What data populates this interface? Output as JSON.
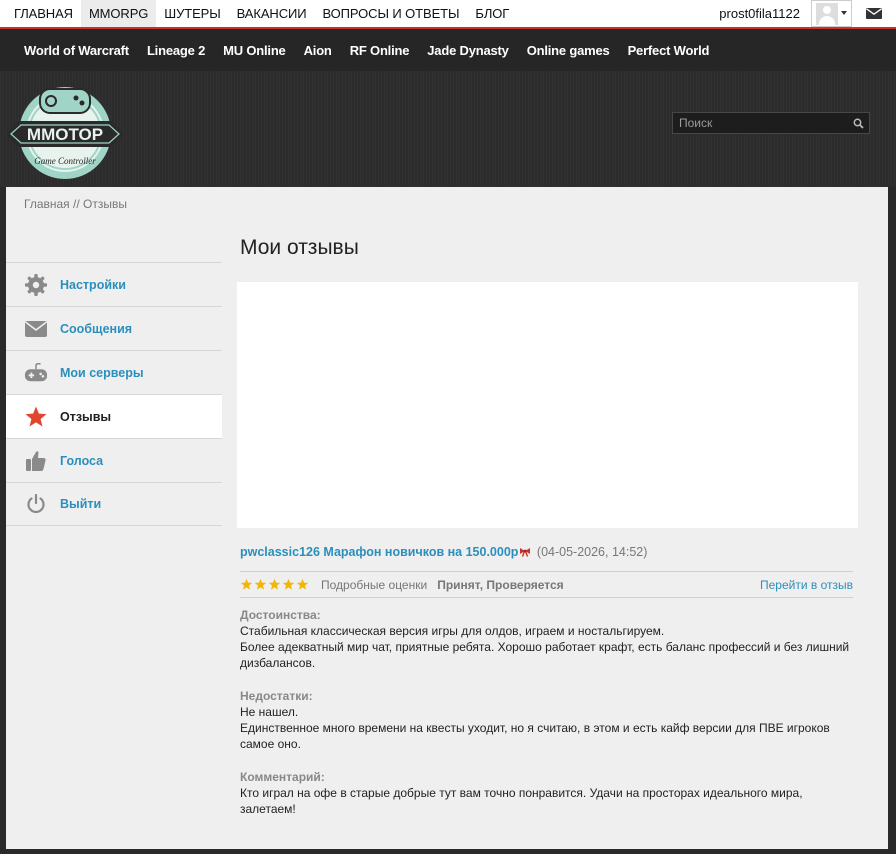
{
  "topnav": {
    "items": [
      "ГЛАВНАЯ",
      "MMORPG",
      "ШУТЕРЫ",
      "ВАКАНСИИ",
      "ВОПРОСЫ И ОТВЕТЫ",
      "БЛОГ"
    ],
    "active_index": 1,
    "username": "prost0fila1122"
  },
  "games": [
    "World of Warcraft",
    "Lineage 2",
    "MU Online",
    "Aion",
    "RF Online",
    "Jade Dynasty",
    "Online games",
    "Perfect World"
  ],
  "logo": {
    "text": "MMOTOP",
    "subtitle": "Game Controller"
  },
  "search": {
    "placeholder": "Поиск"
  },
  "breadcrumb": {
    "home": "Главная",
    "separator": "//",
    "current": "Отзывы"
  },
  "sidebar": [
    {
      "label": "Настройки",
      "icon": "gear-icon"
    },
    {
      "label": "Сообщения",
      "icon": "envelope-icon"
    },
    {
      "label": "Мои серверы",
      "icon": "gamepad-icon"
    },
    {
      "label": "Отзывы",
      "icon": "star-icon",
      "active": true
    },
    {
      "label": "Голоса",
      "icon": "thumbs-up-icon"
    },
    {
      "label": "Выйти",
      "icon": "power-icon"
    }
  ],
  "page_title": "Мои отзывы",
  "review": {
    "server_name": "pwclassic126 Марафон новичков на 150.000р",
    "date": "(04-05-2026, 14:52)",
    "rating": 5,
    "detailed_label": "Подробные оценки",
    "status": "Принят, Проверяется",
    "goto_label": "Перейти в отзыв",
    "pros_heading": "Достоинства:",
    "pros_lines": [
      "Стабильная классическая версия игры для олдов, играем и ностальгируем.",
      "Более адекватный мир чат, приятные ребята. Хорошо работает крафт, есть баланс профессий и без лишний дизбалансов."
    ],
    "cons_heading": "Недостатки:",
    "cons_lines": [
      "Не нашел.",
      "Единственное много времени на квесты уходит, но я считаю, в этом и есть кайф версии для ПВЕ игроков самое оно."
    ],
    "comment_heading": "Комментарий:",
    "comment_lines": [
      "Кто играл на офе в старые добрые тут вам точно понравится. Удачи на просторах идеального мира, залетаем!"
    ]
  },
  "colors": {
    "accent_red": "#c8322c",
    "link_blue": "#2a8fbd",
    "star_gold": "#f2b705",
    "header_dark": "#262626",
    "panel_bg": "#efefef",
    "logo_teal": "#9fd4c7"
  }
}
